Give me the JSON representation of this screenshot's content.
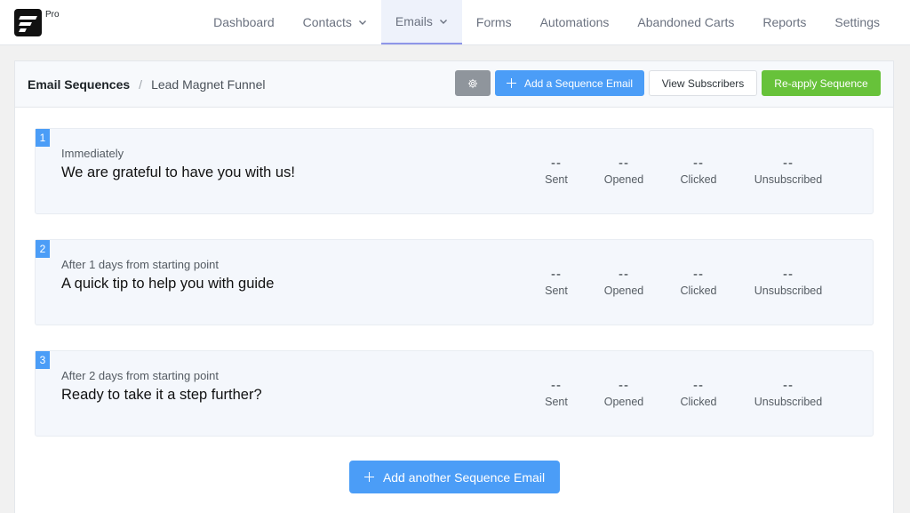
{
  "app": {
    "badge": "Pro"
  },
  "nav": {
    "items": [
      {
        "label": "Dashboard",
        "dropdown": false,
        "active": false
      },
      {
        "label": "Contacts",
        "dropdown": true,
        "active": false
      },
      {
        "label": "Emails",
        "dropdown": true,
        "active": true
      },
      {
        "label": "Forms",
        "dropdown": false,
        "active": false
      },
      {
        "label": "Automations",
        "dropdown": false,
        "active": false
      },
      {
        "label": "Abandoned Carts",
        "dropdown": false,
        "active": false
      },
      {
        "label": "Reports",
        "dropdown": false,
        "active": false
      },
      {
        "label": "Settings",
        "dropdown": false,
        "active": false
      }
    ]
  },
  "header": {
    "breadcrumb_root": "Email Sequences",
    "breadcrumb_separator": "/",
    "breadcrumb_current": "Lead Magnet Funnel",
    "settings_icon": "gear-icon",
    "add_label": "Add a Sequence Email",
    "view_label": "View Subscribers",
    "reapply_label": "Re-apply Sequence"
  },
  "sequences": [
    {
      "number": "1",
      "delay": "Immediately",
      "subject": "We are grateful to have you with us!",
      "stats": [
        {
          "value": "--",
          "label": "Sent"
        },
        {
          "value": "--",
          "label": "Opened"
        },
        {
          "value": "--",
          "label": "Clicked"
        },
        {
          "value": "--",
          "label": "Unsubscribed"
        }
      ]
    },
    {
      "number": "2",
      "delay": "After 1 days from starting point",
      "subject": "A quick tip to help you with guide",
      "stats": [
        {
          "value": "--",
          "label": "Sent"
        },
        {
          "value": "--",
          "label": "Opened"
        },
        {
          "value": "--",
          "label": "Clicked"
        },
        {
          "value": "--",
          "label": "Unsubscribed"
        }
      ]
    },
    {
      "number": "3",
      "delay": "After 2 days from starting point",
      "subject": "Ready to take it a step further?",
      "stats": [
        {
          "value": "--",
          "label": "Sent"
        },
        {
          "value": "--",
          "label": "Opened"
        },
        {
          "value": "--",
          "label": "Clicked"
        },
        {
          "value": "--",
          "label": "Unsubscribed"
        }
      ]
    }
  ],
  "footer": {
    "add_another_label": "Add another Sequence Email"
  },
  "colors": {
    "primary": "#4b9df7",
    "success": "#67c23a",
    "muted_button": "#8f959c",
    "card_background": "#f4f7fc"
  }
}
